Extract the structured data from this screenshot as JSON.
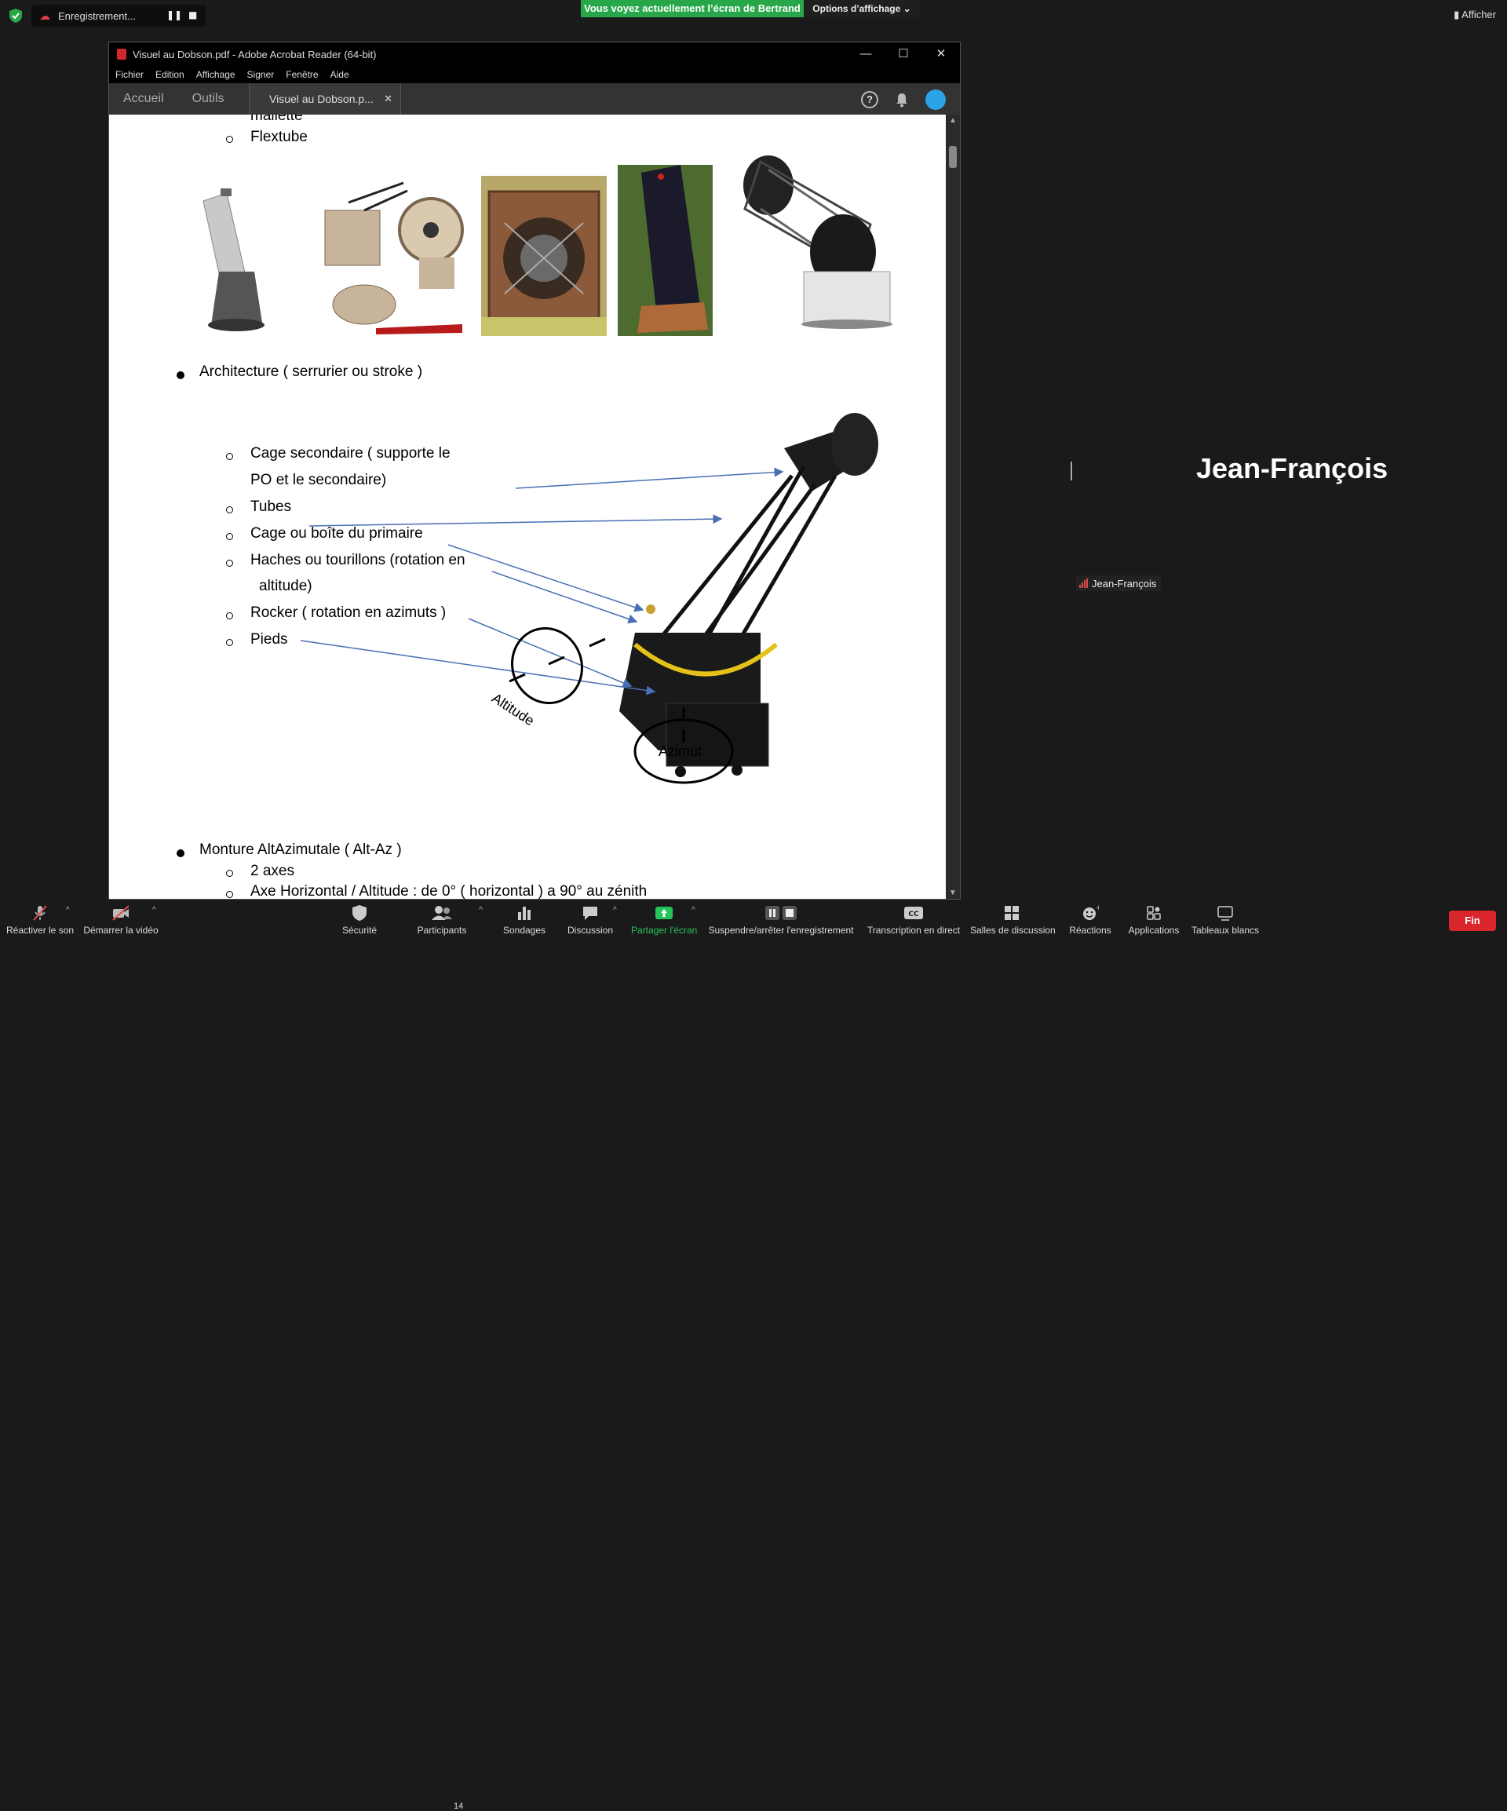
{
  "zoom_top": {
    "recording_label": "Enregistrement...",
    "share_banner": "Vous voyez actuellement l’écran de Bertrand",
    "view_options": "Options d’affichage",
    "show_label": "Afficher"
  },
  "acrobat": {
    "window_title": "Visuel au Dobson.pdf - Adobe Acrobat Reader (64-bit)",
    "menu": [
      "Fichier",
      "Edition",
      "Affichage",
      "Signer",
      "Fenêtre",
      "Aide"
    ],
    "tabs": {
      "home": "Accueil",
      "tools": "Outils",
      "document": "Visuel au Dobson.p..."
    },
    "pdf": {
      "top_partial": "mallette",
      "flextube": "Flextube",
      "architecture": "Architecture ( serrurier ou stroke )",
      "parts": [
        "Cage secondaire ( supporte le",
        "PO  et le secondaire)",
        "Tubes",
        "Cage ou boîte du primaire",
        "Haches ou tourillons (rotation en",
        "altitude)",
        "Rocker ( rotation en azimuts )",
        "Pieds"
      ],
      "altitude_label": "Altitude",
      "azimut_label": "Azimut",
      "monture": "Monture AltAzimutale ( Alt-Az )",
      "axes": "2 axes",
      "axe_horizontal": "Axe Horizontal / Altitude : de 0° ( horizontal ) a 90° au zénith"
    }
  },
  "participant": {
    "name_big": "Jean-François",
    "name_tag": "Jean-François"
  },
  "toolbar": {
    "unmute": "Réactiver le son",
    "start_video": "Démarrer la vidéo",
    "security": "Sécurité",
    "participants": "Participants",
    "participants_count": "14",
    "polls": "Sondages",
    "chat": "Discussion",
    "share": "Partager l'écran",
    "record": "Suspendre/arrêter l'enregistrement",
    "transcription": "Transcription en direct",
    "breakout": "Salles de discussion",
    "reactions": "Réactions",
    "apps": "Applications",
    "whiteboards": "Tableaux blancs",
    "end": "Fin"
  },
  "colors": {
    "share_green": "#27a749",
    "end_red": "#d9262d",
    "arrow_blue": "#4a6fb5",
    "avatar_blue": "#2aa3e8"
  }
}
